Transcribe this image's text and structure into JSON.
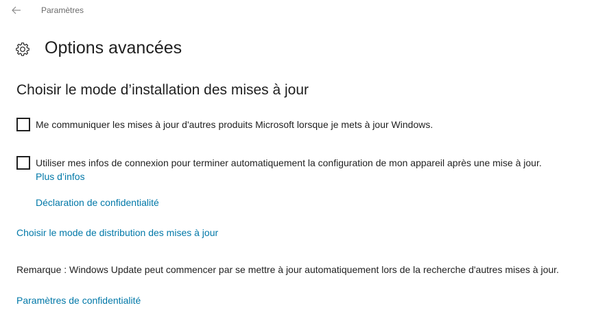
{
  "titlebar": {
    "app_title": "Paramètres"
  },
  "header": {
    "title": "Options avancées",
    "icon": "gear-icon"
  },
  "section": {
    "title": "Choisir le mode d’installation des mises à jour"
  },
  "options": [
    {
      "label": "Me communiquer les mises à jour d'autres produits Microsoft lorsque je mets à jour Windows.",
      "checked": false
    },
    {
      "label": "Utiliser mes infos de connexion pour terminer automatiquement la configuration de mon appareil après une mise à jour.",
      "checked": false
    }
  ],
  "links": {
    "more_info": "Plus d’infos",
    "privacy_statement": "Déclaration de confidentialité",
    "delivery_mode": "Choisir le mode de distribution des mises à jour",
    "privacy_settings": "Paramètres de confidentialité"
  },
  "note": "Remarque : Windows Update peut commencer par se mettre à jour automatiquement lors de la recherche d'autres mises à jour.",
  "colors": {
    "link": "#0078a8",
    "text": "#1f1f1f",
    "muted": "#6b6b6b"
  }
}
